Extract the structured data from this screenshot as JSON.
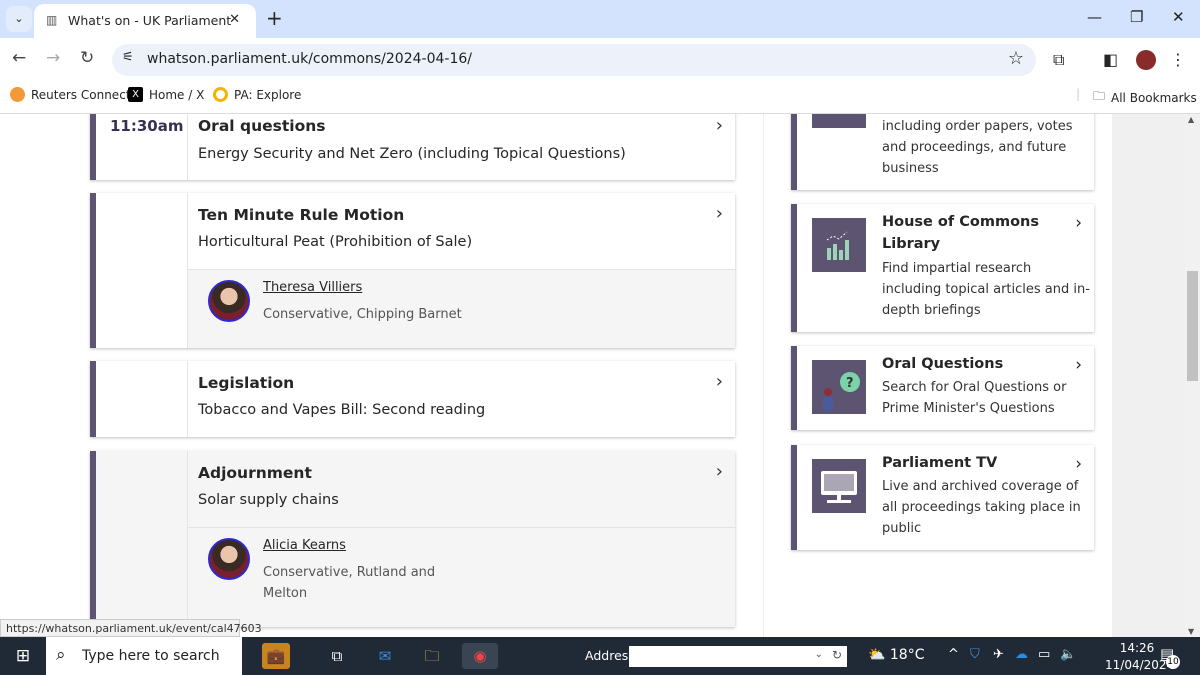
{
  "browser": {
    "tab_title": "What's on - UK Parliament",
    "url": "whatson.parliament.uk/commons/2024-04-16/",
    "bookmarks": [
      "Reuters Connect",
      "Home / X",
      "PA: Explore"
    ],
    "all_bookmarks": "All Bookmarks",
    "status_url": "https://whatson.parliament.uk/event/cal47603"
  },
  "events": [
    {
      "time": "11:30am",
      "title": "Oral questions",
      "subtitle": "Energy Security and Net Zero (including Topical Questions)"
    },
    {
      "time": "",
      "title": "Ten Minute Rule Motion",
      "subtitle": "Horticultural Peat (Prohibition of Sale)",
      "member": {
        "name": "Theresa Villiers",
        "party": "Conservative, Chipping Barnet"
      }
    },
    {
      "time": "",
      "title": "Legislation",
      "subtitle": "Tobacco and Vapes Bill: Second reading"
    },
    {
      "time": "",
      "title": "Adjournment",
      "subtitle": "Solar supply chains",
      "member": {
        "name": "Alicia Kearns",
        "party": "Conservative, Rutland and Melton"
      }
    }
  ],
  "sidebar": [
    {
      "title": "",
      "desc": "including order papers, votes and proceedings, and future business",
      "icon": "documents-icon"
    },
    {
      "title": "House of Commons Library",
      "desc": "Find impartial research including topical articles and in-depth briefings",
      "icon": "chart-icon"
    },
    {
      "title": "Oral Questions",
      "desc": "Search for Oral Questions or Prime Minister's Questions",
      "icon": "question-icon"
    },
    {
      "title": "Parliament TV",
      "desc": "Live and archived coverage of all proceedings taking place in public",
      "icon": "monitor-icon"
    }
  ],
  "taskbar": {
    "search_placeholder": "Type here to search",
    "address_label": "Address",
    "temperature": "18°C",
    "time": "14:26",
    "date": "11/04/2024",
    "notifications": "10"
  },
  "colors": {
    "accent": "#5c5470",
    "tab_bar": "#d3e3fd",
    "taskbar": "#202a36"
  }
}
